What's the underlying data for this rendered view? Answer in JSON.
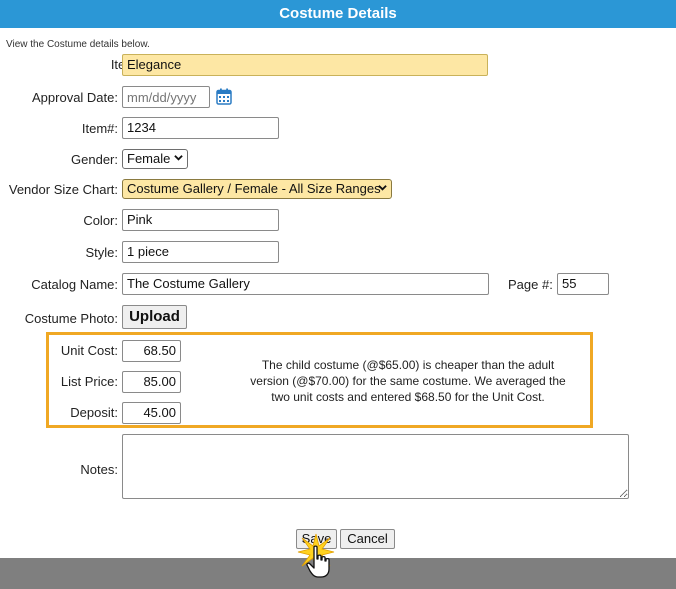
{
  "header": {
    "title": "Costume Details"
  },
  "intro": "View the Costume details below.",
  "fields": {
    "item_name": {
      "label": "Item Name:",
      "value": "Elegance"
    },
    "approval_date": {
      "label": "Approval Date:",
      "placeholder": "mm/dd/yyyy"
    },
    "item_number": {
      "label": "Item#:",
      "value": "1234"
    },
    "gender": {
      "label": "Gender:",
      "value": "Female"
    },
    "vendor_size_chart": {
      "label": "Vendor Size Chart:",
      "value": "Costume Gallery / Female - All Size Ranges"
    },
    "color": {
      "label": "Color:",
      "value": "Pink"
    },
    "style": {
      "label": "Style:",
      "value": "1 piece"
    },
    "catalog_name": {
      "label": "Catalog Name:",
      "value": "The Costume Gallery"
    },
    "page_number": {
      "label": "Page #:",
      "value": "55"
    },
    "costume_photo": {
      "label": "Costume Photo:",
      "button": "Upload"
    },
    "unit_cost": {
      "label": "Unit Cost:",
      "value": "68.50"
    },
    "list_price": {
      "label": "List Price:",
      "value": "85.00"
    },
    "deposit": {
      "label": "Deposit:",
      "value": "45.00"
    },
    "notes": {
      "label": "Notes:",
      "value": ""
    }
  },
  "cost_note": "The child costume (@$65.00) is cheaper than the adult version (@$70.00) for the same costume. We averaged the two unit costs and entered $68.50 for the Unit Cost.",
  "actions": {
    "save": "Save",
    "cancel": "Cancel"
  },
  "colors": {
    "header": "#2b97d6",
    "highlight": "#fde7a4",
    "annotation_border": "#f0a824",
    "footer": "#7f7f7f"
  },
  "icons": {
    "calendar": "calendar-icon",
    "cursor": "hand-pointer-icon"
  }
}
